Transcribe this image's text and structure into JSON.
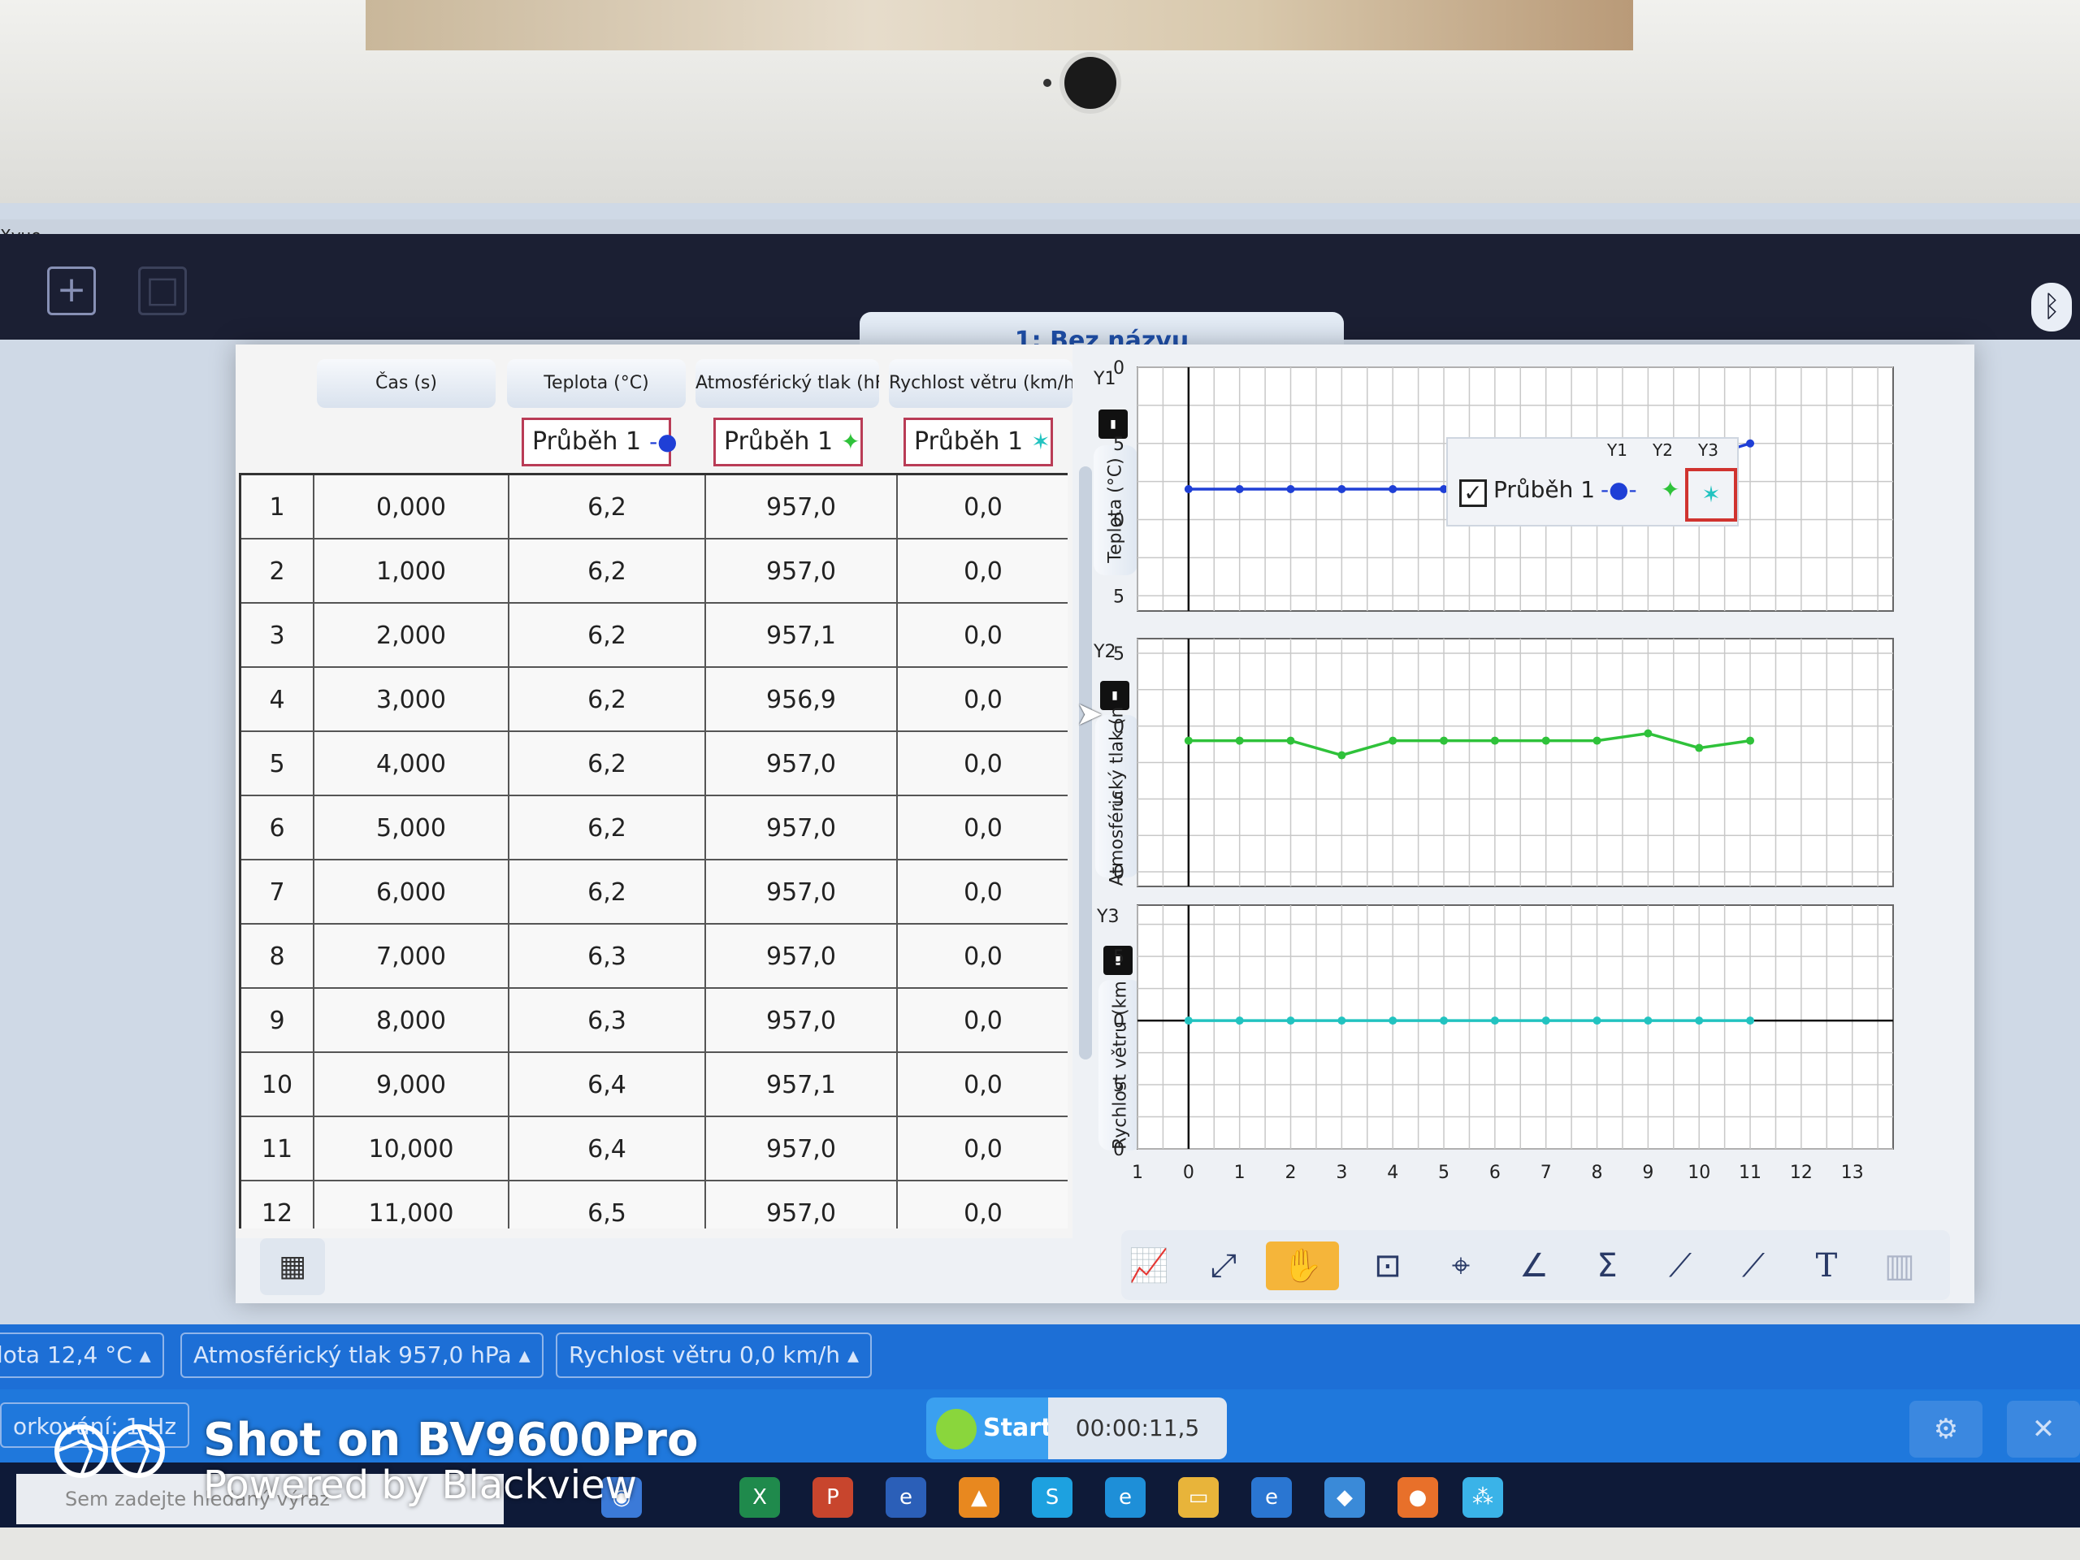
{
  "app": {
    "title_fragment": "Xvue",
    "document_tab": "1: Bez názvu"
  },
  "table": {
    "columns": [
      "Čas (s)",
      "Teplota (°C)",
      "Atmosférický tlak (hPa)",
      "Rychlost větru (km/h)"
    ],
    "columns_visible": [
      "Čas (s)",
      "Teplota (°C)",
      "Atmosférický tlak (hF",
      "Rychlost větru (km/h"
    ],
    "series_label": "Průběh 1",
    "rows": [
      {
        "n": "1",
        "cas": "0,000",
        "teplota": "6,2",
        "tlak": "957,0",
        "vitr": "0,0"
      },
      {
        "n": "2",
        "cas": "1,000",
        "teplota": "6,2",
        "tlak": "957,0",
        "vitr": "0,0"
      },
      {
        "n": "3",
        "cas": "2,000",
        "teplota": "6,2",
        "tlak": "957,1",
        "vitr": "0,0"
      },
      {
        "n": "4",
        "cas": "3,000",
        "teplota": "6,2",
        "tlak": "956,9",
        "vitr": "0,0"
      },
      {
        "n": "5",
        "cas": "4,000",
        "teplota": "6,2",
        "tlak": "957,0",
        "vitr": "0,0"
      },
      {
        "n": "6",
        "cas": "5,000",
        "teplota": "6,2",
        "tlak": "957,0",
        "vitr": "0,0"
      },
      {
        "n": "7",
        "cas": "6,000",
        "teplota": "6,2",
        "tlak": "957,0",
        "vitr": "0,0"
      },
      {
        "n": "8",
        "cas": "7,000",
        "teplota": "6,3",
        "tlak": "957,0",
        "vitr": "0,0"
      },
      {
        "n": "9",
        "cas": "8,000",
        "teplota": "6,3",
        "tlak": "957,0",
        "vitr": "0,0"
      },
      {
        "n": "10",
        "cas": "9,000",
        "teplota": "6,4",
        "tlak": "957,1",
        "vitr": "0,0"
      },
      {
        "n": "11",
        "cas": "10,000",
        "teplota": "6,4",
        "tlak": "957,0",
        "vitr": "0,0"
      },
      {
        "n": "12",
        "cas": "11,000",
        "teplota": "6,5",
        "tlak": "957,0",
        "vitr": "0,0"
      }
    ]
  },
  "axes": {
    "y1": {
      "tag": "Y1",
      "label": "Teplota (°C)"
    },
    "y2": {
      "tag": "Y2",
      "label": "Atmosférický tlak (n"
    },
    "y3": {
      "tag": "Y3",
      "label": "Rychlost větru (km"
    }
  },
  "legend": {
    "headers": [
      "Y1",
      "Y2",
      "Y3"
    ],
    "series": "Průběh 1",
    "checked": true
  },
  "chart_data": [
    {
      "type": "line",
      "x": [
        0,
        1,
        2,
        3,
        4,
        5,
        6,
        7,
        8,
        9,
        10,
        11
      ],
      "series": [
        {
          "values": [
            6.2,
            6.2,
            6.2,
            6.2,
            6.2,
            6.2,
            6.2,
            6.3,
            6.3,
            6.4,
            6.4,
            6.5
          ],
          "color": "#1f3fd6"
        }
      ],
      "ylim": [
        5.4,
        7.0
      ],
      "yticks": [
        "7,0",
        "6,5",
        "6,0",
        "5,5"
      ],
      "ytick_values": [
        7.0,
        6.5,
        6.0,
        5.5
      ],
      "xlim": [
        -1,
        13.8
      ]
    },
    {
      "type": "line",
      "x": [
        0,
        1,
        2,
        3,
        4,
        5,
        6,
        7,
        8,
        9,
        10,
        11
      ],
      "series": [
        {
          "values": [
            717.9,
            717.9,
            717.9,
            717.8,
            717.9,
            717.9,
            717.9,
            717.9,
            717.9,
            717.95,
            717.85,
            717.9
          ],
          "color": "#2fc23a"
        }
      ],
      "ylim": [
        716.9,
        718.6
      ],
      "yticks": [
        "718,5",
        "718,0",
        "717,5",
        "717,0"
      ],
      "ytick_values": [
        718.5,
        718.0,
        717.5,
        717.0
      ],
      "xlim": [
        -1,
        13.8
      ]
    },
    {
      "type": "line",
      "x": [
        0,
        1,
        2,
        3,
        4,
        5,
        6,
        7,
        8,
        9,
        10,
        11
      ],
      "series": [
        {
          "values": [
            0,
            0,
            0,
            0,
            0,
            0,
            0,
            0,
            0,
            0,
            0,
            0
          ],
          "color": "#22c3c0"
        }
      ],
      "ylim": [
        -1.0,
        0.9
      ],
      "yticks": [
        "0,5",
        "0,0",
        "-0,5",
        "-1,0"
      ],
      "ytick_values": [
        0.5,
        0.0,
        -0.5,
        -1.0
      ],
      "xlim": [
        -1,
        13.8
      ],
      "xticks": [
        "1",
        "0",
        "1",
        "2",
        "3",
        "4",
        "5",
        "6",
        "7",
        "8",
        "9",
        "10",
        "11",
        "12",
        "13"
      ],
      "xtick_values": [
        -1,
        0,
        1,
        2,
        3,
        4,
        5,
        6,
        7,
        8,
        9,
        10,
        11,
        12,
        13
      ]
    }
  ],
  "status": {
    "temp_chip": "lota 12,4 °C",
    "pressure_chip": "Atmosférický tlak 957,0 hPa",
    "wind_chip": "Rychlost větru 0,0 km/h",
    "rate": "orkování: 1 Hz",
    "start": "Start",
    "timer": "00:00:11,5"
  },
  "taskbar": {
    "search_placeholder": "Sem zadejte hledaný výraz"
  },
  "watermark": {
    "line1": "Shot on BV9600Pro",
    "line2": "Powered by Blackview"
  },
  "colors": {
    "y1": "#1f3fd6",
    "y2": "#2fc23a",
    "y3": "#22c3c0",
    "status_bar": "#1d6fd6",
    "series_box_border": "#b93c56"
  },
  "icons": [
    "new-document-icon",
    "bluetooth-icon",
    "lock-icon",
    "table-view-icon",
    "autoscale-icon",
    "zoom-extents-icon",
    "pan-hand-icon",
    "select-region-icon",
    "examine-icon",
    "tangent-icon",
    "sigma-statistics-icon",
    "curve-fit-icon",
    "linear-fit-icon",
    "text-annotation-icon",
    "sensor-settings-icon",
    "tools-icon"
  ]
}
